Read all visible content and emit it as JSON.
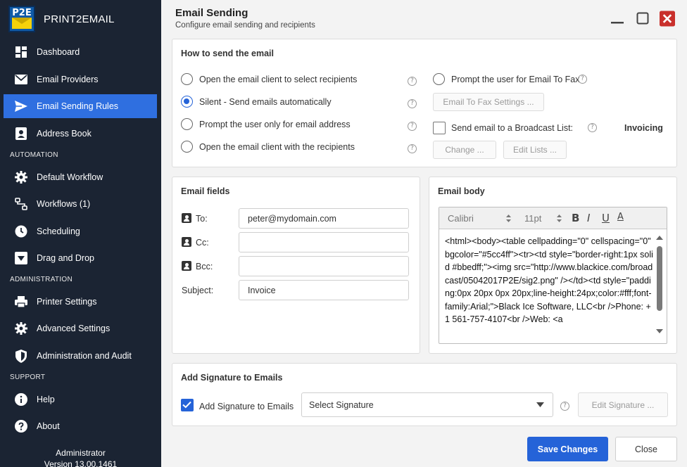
{
  "app": {
    "logo_text": "P2E",
    "name": "PRINT2EMAIL"
  },
  "sidebar": {
    "items": [
      {
        "label": "Dashboard",
        "icon": "dashboard-icon"
      },
      {
        "label": "Email Providers",
        "icon": "envelope-icon"
      },
      {
        "label": "Email Sending Rules",
        "icon": "send-icon",
        "active": true
      },
      {
        "label": "Address Book",
        "icon": "contact-card-icon"
      },
      {
        "label": "Default Workflow",
        "icon": "gear-icon"
      },
      {
        "label": "Workflows (1)",
        "icon": "workflow-icon"
      },
      {
        "label": "Scheduling",
        "icon": "clock-icon"
      },
      {
        "label": "Drag and Drop",
        "icon": "drop-icon"
      },
      {
        "label": "Printer Settings",
        "icon": "printer-icon"
      },
      {
        "label": "Advanced Settings",
        "icon": "gear-icon"
      },
      {
        "label": "Administration and Audit",
        "icon": "shield-icon"
      },
      {
        "label": "Help",
        "icon": "info-icon"
      },
      {
        "label": "About",
        "icon": "question-icon"
      }
    ],
    "sections": {
      "automation": "AUTOMATION",
      "administration": "ADMINISTRATION",
      "support": "SUPPORT"
    },
    "footer": {
      "user": "Administrator",
      "version": "Version 13.00.1461"
    }
  },
  "header": {
    "title": "Email Sending",
    "subtitle": "Configure email sending and recipients"
  },
  "how_to_send": {
    "title": "How to send the email",
    "options": [
      {
        "label": "Open the email client to select recipients",
        "selected": false
      },
      {
        "label": "Silent - Send emails automatically",
        "selected": true
      },
      {
        "label": "Prompt the user only for email address",
        "selected": false
      },
      {
        "label": "Open the email client with the recipients",
        "selected": false
      }
    ],
    "fax_option_label": "Prompt the user for Email To Fax",
    "fax_settings_button": "Email To Fax Settings ...",
    "broadcast_label": "Send email to a Broadcast List:",
    "broadcast_checked": false,
    "broadcast_value": "Invoicing",
    "change_button": "Change ...",
    "edit_lists_button": "Edit Lists ..."
  },
  "email_fields": {
    "title": "Email fields",
    "to_label": "To:",
    "to_value": "peter@mydomain.com",
    "cc_label": "Cc:",
    "cc_value": "",
    "bcc_label": "Bcc:",
    "bcc_value": "",
    "subject_label": "Subject:",
    "subject_value": "Invoice"
  },
  "email_body": {
    "title": "Email body",
    "font": "Calibri",
    "size": "11pt",
    "format_buttons": {
      "bold": "B",
      "italic": "I",
      "underline": "U",
      "color": "A"
    },
    "content": "<html><body><table cellpadding=\"0\" cellspacing=\"0\" bgcolor=\"#5cc4ff\"><tr><td style=\"border-right:1px solid #bbedff;\"><img src=\"http://www.blackice.com/broadcast/05042017P2E/sig2.png\" /></td><td style=\"padding:0px 20px 0px 20px;line-height:24px;color:#fff;font-family:Arial;\">Black Ice Software, LLC<br />Phone: +1 561-757-4107<br />Web: <a"
  },
  "signature": {
    "title": "Add Signature to Emails",
    "checkbox_label": "Add Signature to Emails",
    "checked": true,
    "select_placeholder": "Select Signature",
    "edit_button": "Edit Signature ..."
  },
  "footer_buttons": {
    "save": "Save Changes",
    "close": "Close"
  },
  "colors": {
    "sidebar_bg": "#1b2433",
    "accent": "#2563d8",
    "active_nav": "#2f6fe0",
    "close_btn": "#c9302c"
  }
}
